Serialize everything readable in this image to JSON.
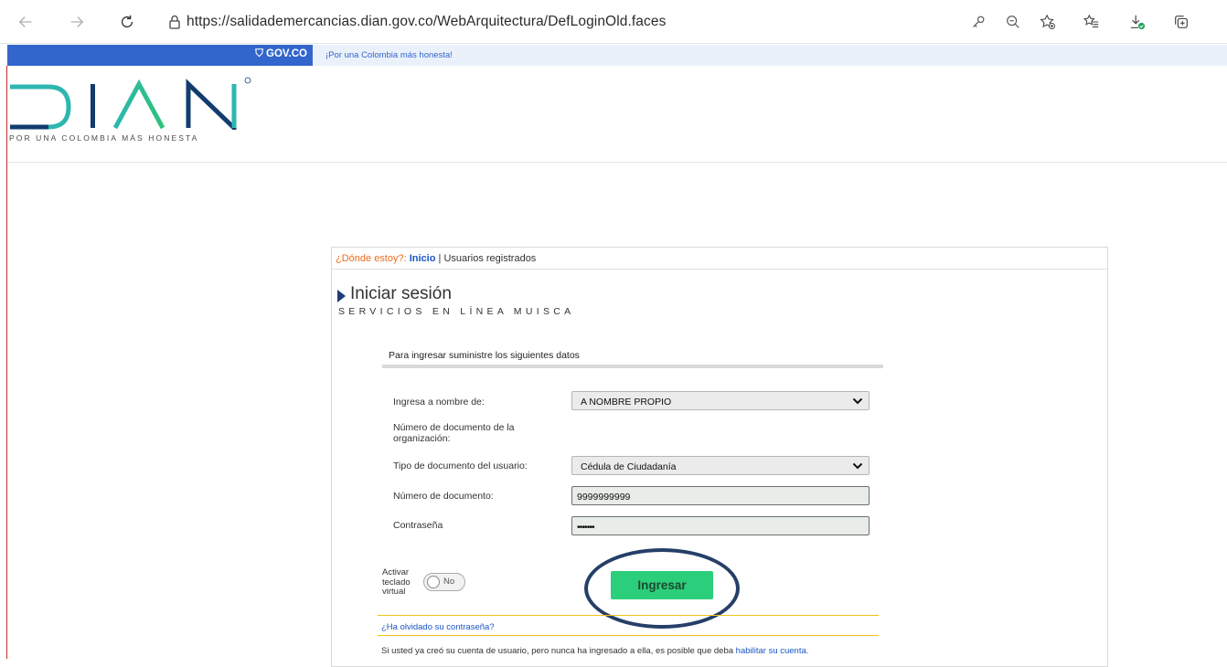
{
  "browser": {
    "url": "https://salidademercancias.dian.gov.co/WebArquitectura/DefLoginOld.faces"
  },
  "gov_bar": {
    "logo": "GOV.CO",
    "slogan": "¡Por una Colombia más honesta!"
  },
  "header": {
    "logo_text": "DIAN",
    "tagline": "POR UNA COLOMBIA MÁS HONESTA"
  },
  "breadcrumb": {
    "question": "¿Dónde estoy?:",
    "home": "Inicio",
    "separator": " | ",
    "current": "Usuarios registrados"
  },
  "page": {
    "title": "Iniciar sesión",
    "subtitle": "SERVICIOS EN LÍNEA MUISCA"
  },
  "form": {
    "header": "Para ingresar suministre los siguientes datos",
    "on_behalf_label": "Ingresa a nombre de:",
    "on_behalf_value": "A NOMBRE PROPIO",
    "org_doc_label_line1": "Número de documento de la",
    "org_doc_label_line2": "organización:",
    "doc_type_label": "Tipo de documento del usuario:",
    "doc_type_value": "Cédula de Ciudadanía",
    "doc_number_label": "Número de documento:",
    "doc_number_value": "9999999999",
    "password_label": "Contraseña",
    "password_value": "•••••••",
    "keyboard_label_1": "Activar",
    "keyboard_label_2": "teclado",
    "keyboard_label_3": "virtual",
    "keyboard_state": "No",
    "login_button": "Ingresar"
  },
  "footer": {
    "forgot_password": "¿Ha olvidado su contraseña?",
    "activate_text": "Si usted ya creó su cuenta de usuario, pero nunca ha ingresado a ella, es posible que deba ",
    "activate_link": "habilitar su cuenta."
  },
  "colors": {
    "gov_blue": "#3366cc",
    "login_green": "#2bce7a",
    "logo_blue": "#123c6e",
    "logo_teal": "#2db7b0",
    "logo_green": "#2fc17a"
  }
}
